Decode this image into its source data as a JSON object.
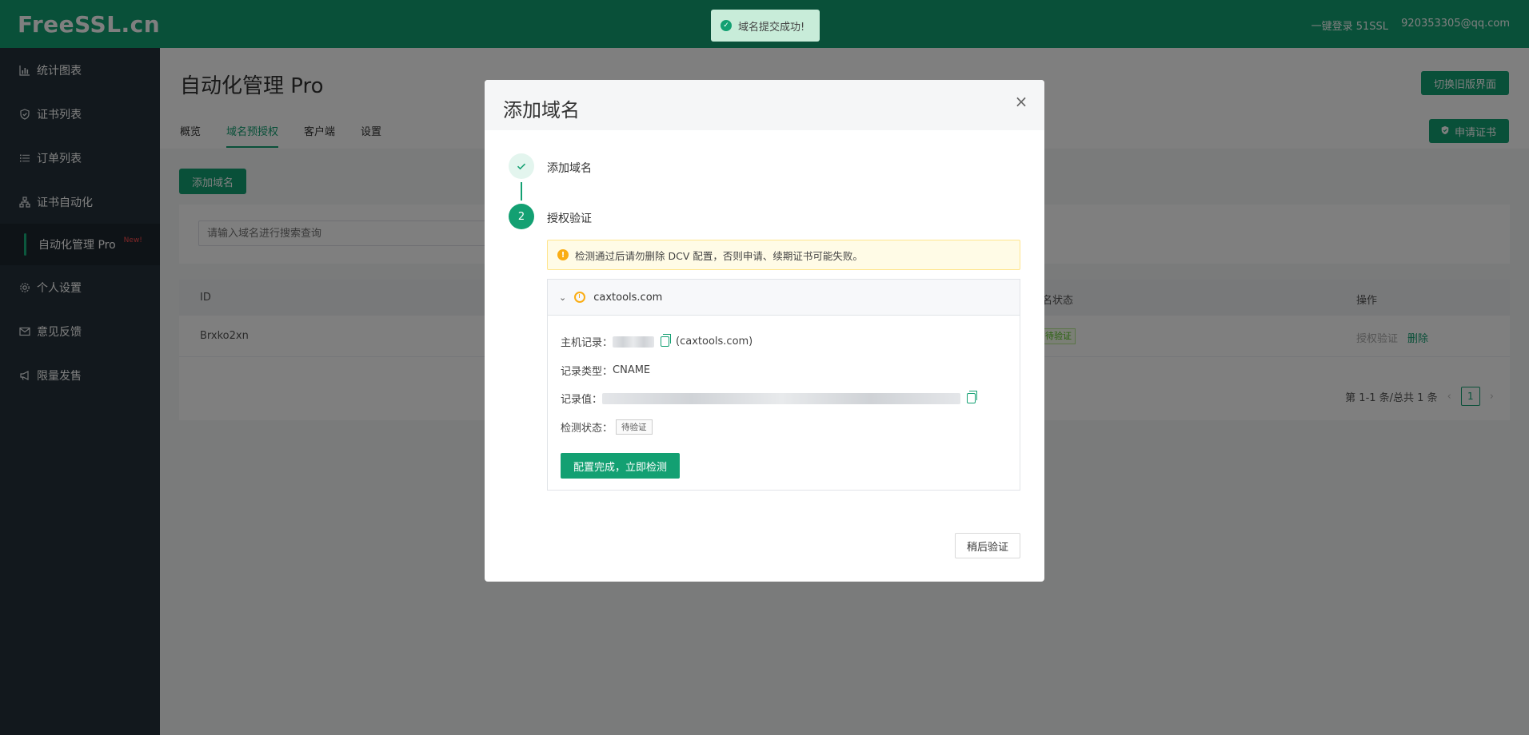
{
  "header": {
    "logo": "FreeSSL.cn",
    "quick_login": "一键登录 51SSL",
    "user_email": "920353305@qq.com"
  },
  "sidebar": {
    "items": [
      {
        "label": "统计图表",
        "icon": "bar-chart-icon"
      },
      {
        "label": "证书列表",
        "icon": "shield-icon"
      },
      {
        "label": "订单列表",
        "icon": "list-icon"
      },
      {
        "label": "证书自动化",
        "icon": "sitemap-icon"
      },
      {
        "label": "个人设置",
        "icon": "gear-icon"
      },
      {
        "label": "意见反馈",
        "icon": "mail-icon"
      },
      {
        "label": "限量发售",
        "icon": "megaphone-icon"
      }
    ],
    "sub_item": {
      "label": "自动化管理 Pro",
      "badge": "New!"
    }
  },
  "main": {
    "title": "自动化管理 Pro",
    "switch_old_label": "切换旧版界面",
    "apply_cert_label": "申请证书",
    "tabs": [
      {
        "label": "概览",
        "active": false
      },
      {
        "label": "域名预授权",
        "active": true
      },
      {
        "label": "客户端",
        "active": false
      },
      {
        "label": "设置",
        "active": false
      }
    ],
    "add_domain_label": "添加域名",
    "search_placeholder": "请输入域名进行搜索查询",
    "table": {
      "col_id": "ID",
      "col_status": "名状态",
      "col_ops": "操作",
      "rows": [
        {
          "id": "Brxko2xn",
          "status": "待验证",
          "op_verify": "授权验证",
          "op_delete": "删除"
        }
      ]
    },
    "pagination": {
      "summary": "第 1-1 条/总共 1 条",
      "current_page": "1"
    }
  },
  "toast": {
    "message": "域名提交成功!"
  },
  "modal": {
    "title": "添加域名",
    "steps": [
      {
        "number": "1",
        "label": "添加域名",
        "state": "done"
      },
      {
        "number": "2",
        "label": "授权验证",
        "state": "active"
      }
    ],
    "warning": "检测通过后请勿删除 DCV 配置，否则申请、续期证书可能失败。",
    "domain": "caxtools.com",
    "records": {
      "host_label": "主机记录：",
      "host_suffix": "(caxtools.com)",
      "type_label": "记录类型：",
      "type_value": "CNAME",
      "value_label": "记录值：",
      "status_label": "检测状态：",
      "status_value": "待验证"
    },
    "check_button": "配置完成，立即检测",
    "later_button": "稍后验证"
  },
  "colors": {
    "brand": "#13a072",
    "sidebar": "#25313a",
    "warning": "#faad14"
  }
}
